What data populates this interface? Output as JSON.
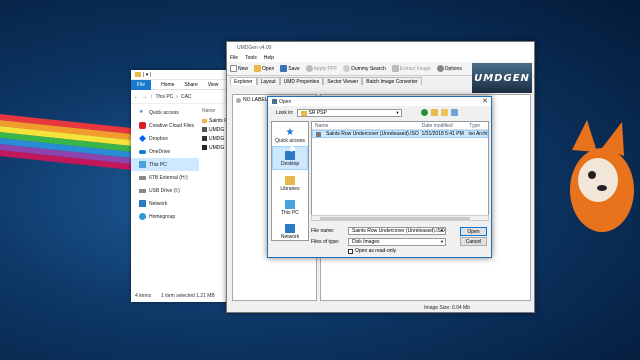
{
  "explorer": {
    "title_path": "| ▾ |",
    "tabs": [
      "File",
      "Home",
      "Share",
      "View"
    ],
    "address": [
      "This PC",
      "CAC"
    ],
    "nav": [
      "Quick access",
      "Creative Cloud Files",
      "Dropbox",
      "OneDrive",
      "This PC",
      "6TB External (H:)",
      "USB Drive (I:)",
      "Network",
      "Homegroup"
    ],
    "column_header": "Name",
    "files": [
      "Saints R",
      "UMDG",
      "UMDG",
      "UMDG"
    ],
    "status": [
      "4 items",
      "1 item selected 1.21 MB"
    ]
  },
  "umd": {
    "title": "UMDGen v4.00",
    "menu": [
      "File",
      "Tools",
      "Help"
    ],
    "toolbar": [
      "New",
      "Open",
      "Save",
      "Apply PPF",
      "Dummy Search",
      "Extract Image",
      "Options"
    ],
    "logo": "UMDGEN",
    "tabs": [
      "Explorer",
      "Layout",
      "UMD Properties",
      "Sector Viewer",
      "Batch Image Converter"
    ],
    "tree_label": "NO LABEL",
    "status": "Image Size: 0.04 Mb"
  },
  "dialog": {
    "title": "Open",
    "close": "✕",
    "look_in_label": "Look in:",
    "look_in_value": "SR PSP",
    "places": [
      "Quick access",
      "Desktop",
      "Libraries",
      "This PC",
      "Network"
    ],
    "columns": [
      "Name",
      "Date modified",
      "Type"
    ],
    "file": {
      "name": "Saints Row Undercover (Unreleased).ISO",
      "date": "1/31/2018 5:41 PM",
      "type": "iso Archive"
    },
    "file_name_label": "File name:",
    "file_name_value": "Saints Row Undercover (Unreleased).ISO",
    "file_type_label": "Files of type:",
    "file_type_value": "Disk Images",
    "readonly_label": "Open as read-only",
    "open_button": "Open",
    "cancel_button": "Cancel"
  },
  "colors": {
    "accent": "#1979ca",
    "selection": "#cde8ff"
  }
}
